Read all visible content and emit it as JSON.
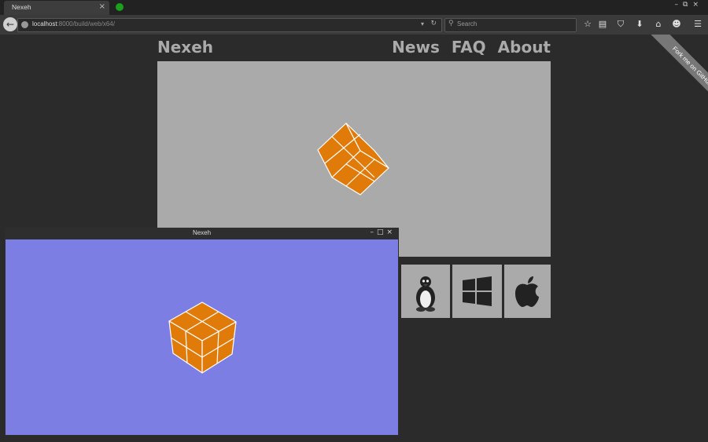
{
  "browser": {
    "tab_title": "Nexeh",
    "tab_close": "×",
    "url_host": "localhost",
    "url_path": ":8000/build/web/x64/",
    "search_placeholder": "Search"
  },
  "page": {
    "brand": "Nexeh",
    "nav": [
      "News",
      "FAQ",
      "About"
    ],
    "ribbon": "Fork me on GitHub",
    "downloads": [
      {
        "icon": "linux-penguin-icon"
      },
      {
        "icon": "windows-logo-icon"
      },
      {
        "icon": "apple-logo-icon"
      }
    ],
    "colors": {
      "canvas": "#aaaaaa",
      "cube": "#e07b0a",
      "app_bg": "#7c7ee3"
    }
  },
  "app_window": {
    "title": "Nexeh"
  }
}
